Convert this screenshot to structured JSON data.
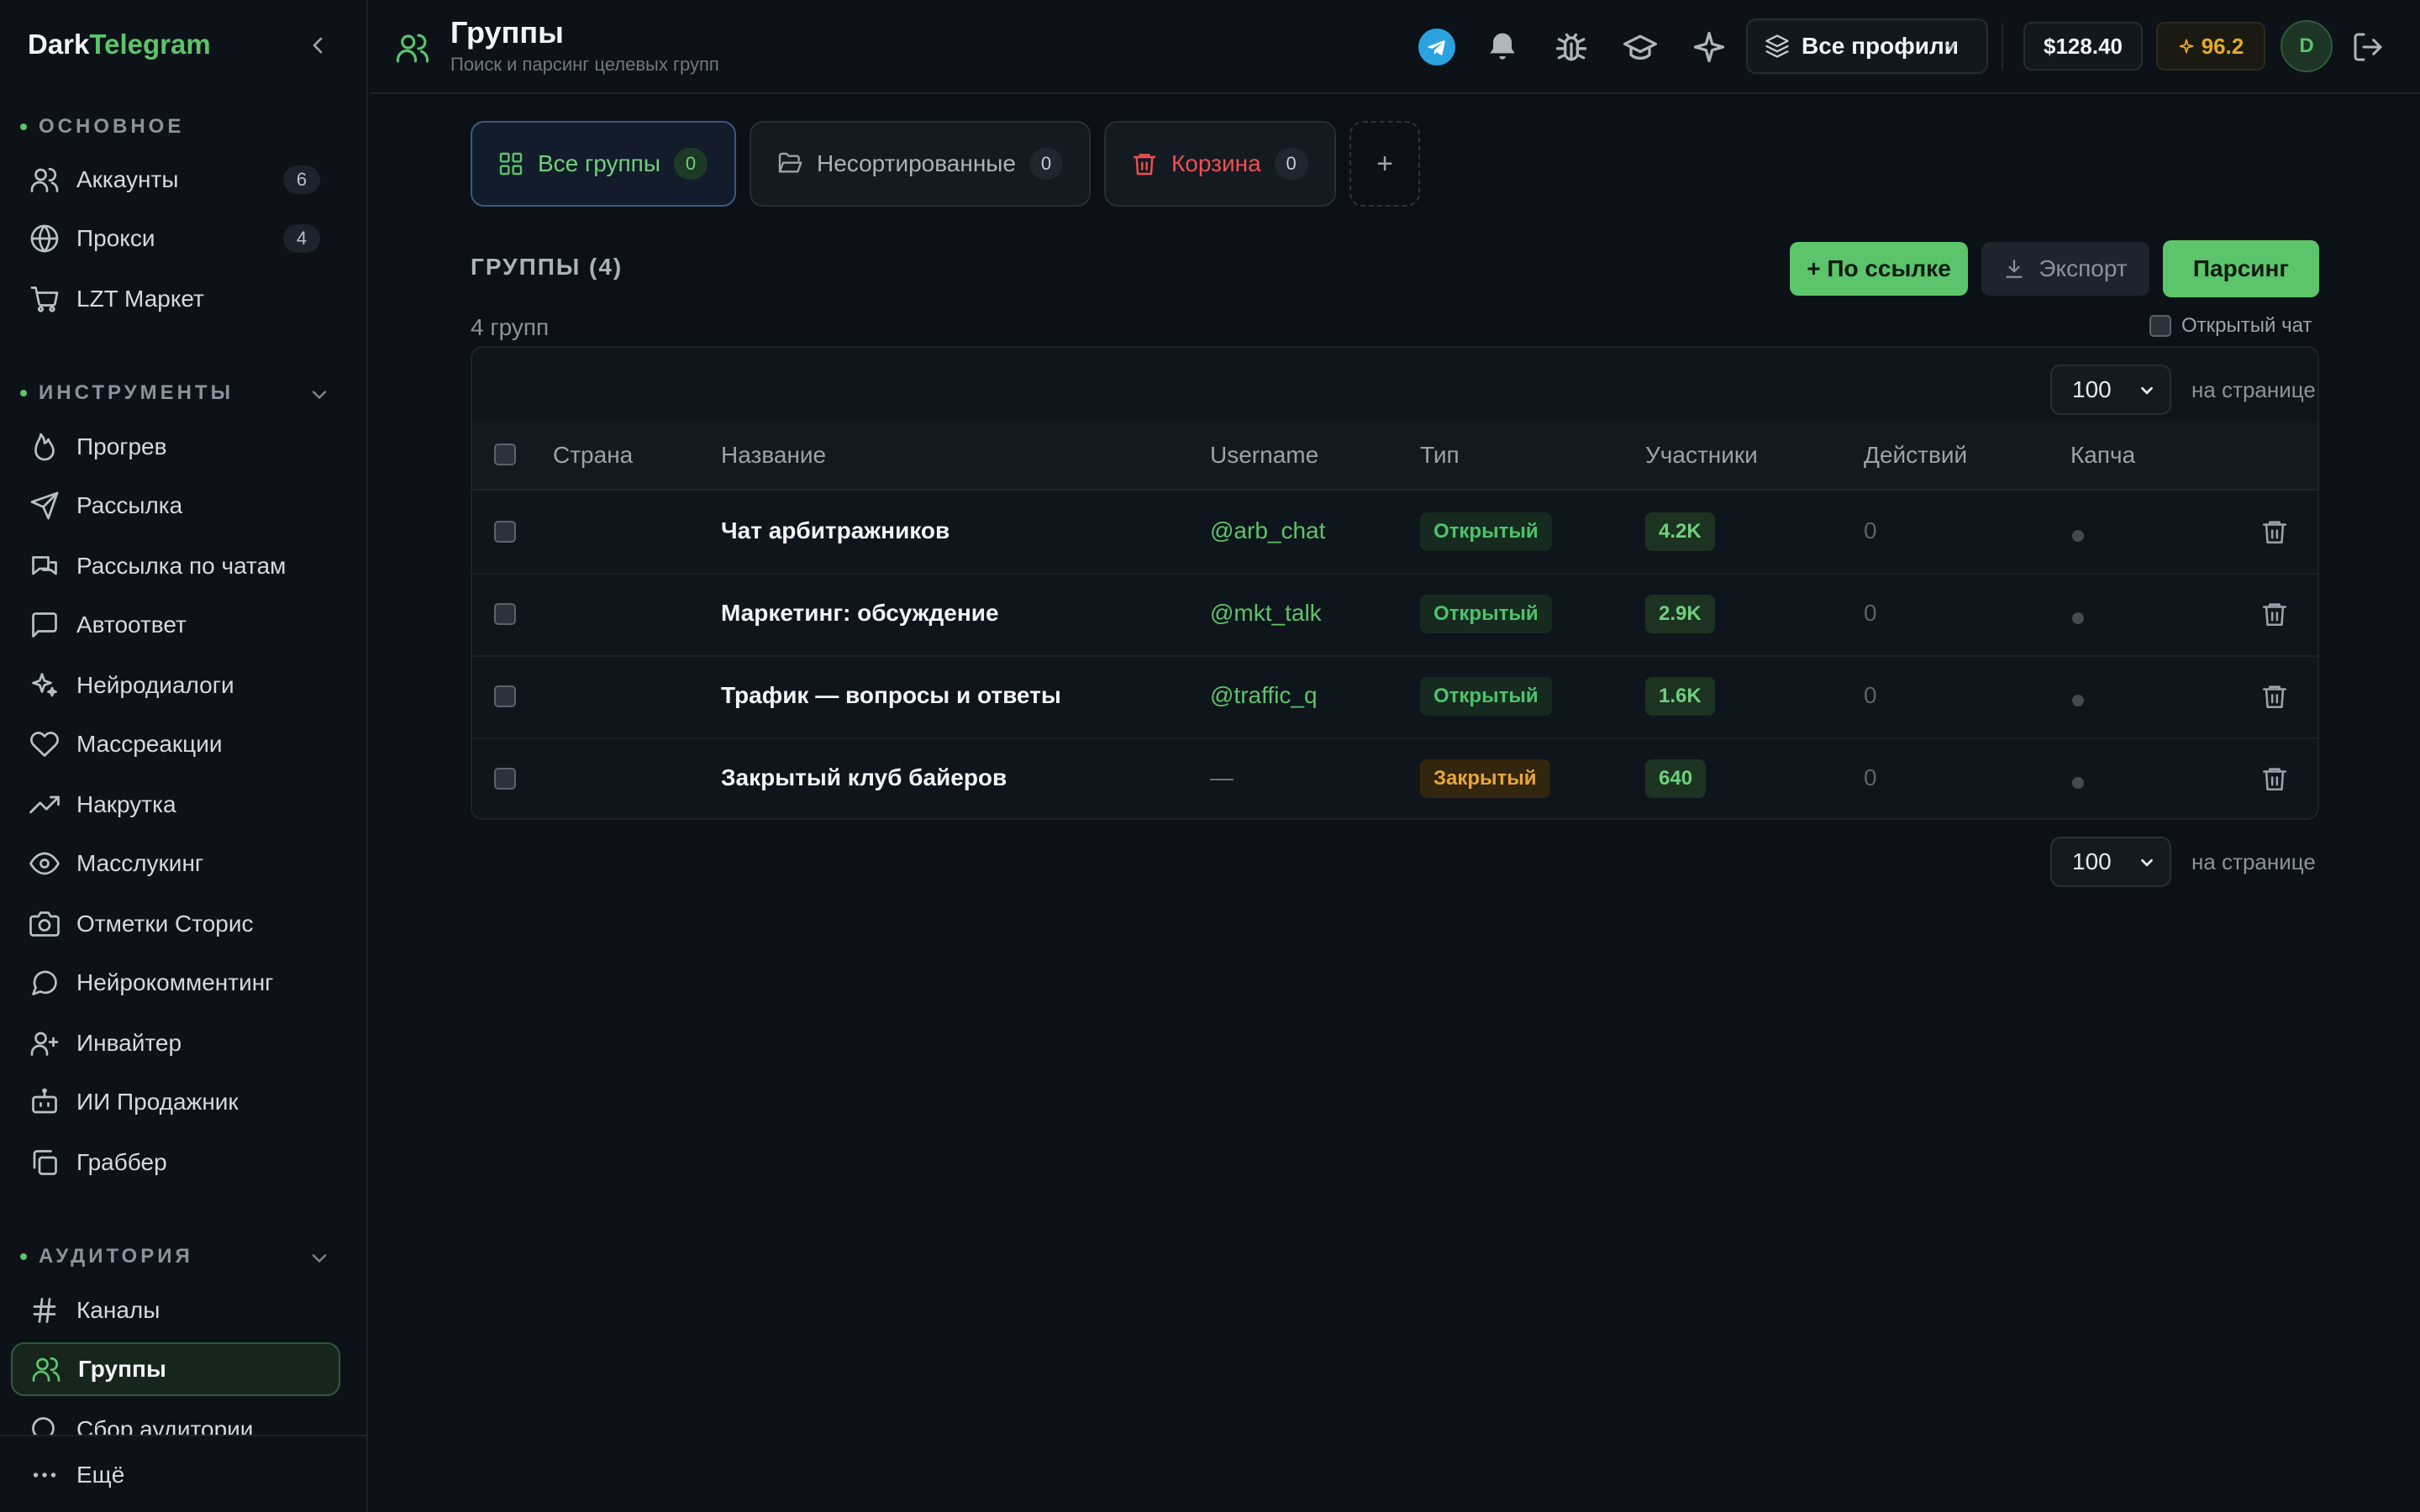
{
  "brand": {
    "part1": "Dark",
    "part2": "Telegram"
  },
  "sidebar": {
    "sections": {
      "main": "ОСНОВНОЕ",
      "tools": "ИНСТРУМЕНТЫ",
      "audience": "АУДИТОРИЯ"
    },
    "main_items": [
      {
        "label": "Аккаунты",
        "count": "6",
        "icon": "users-icon"
      },
      {
        "label": "Прокси",
        "count": "4",
        "icon": "globe-icon"
      },
      {
        "label": "LZT Маркет",
        "icon": "cart-icon"
      }
    ],
    "tools_items": [
      {
        "label": "Прогрев",
        "icon": "flame-icon"
      },
      {
        "label": "Рассылка",
        "icon": "send-icon"
      },
      {
        "label": "Рассылка по чатам",
        "icon": "chats-icon"
      },
      {
        "label": "Автоответ",
        "icon": "message-square-icon"
      },
      {
        "label": "Нейродиалоги",
        "icon": "sparkles-icon"
      },
      {
        "label": "Массреакции",
        "icon": "heart-icon"
      },
      {
        "label": "Накрутка",
        "icon": "trending-up-icon"
      },
      {
        "label": "Масслукинг",
        "icon": "eye-icon"
      },
      {
        "label": "Отметки Сторис",
        "icon": "camera-icon"
      },
      {
        "label": "Нейрокомментинг",
        "icon": "message-circle-icon"
      },
      {
        "label": "Инвайтер",
        "icon": "user-plus-icon"
      },
      {
        "label": "ИИ Продажник",
        "icon": "bot-icon"
      },
      {
        "label": "Граббер",
        "icon": "copy-icon"
      }
    ],
    "audience_items": [
      {
        "label": "Каналы",
        "icon": "hash-icon"
      },
      {
        "label": "Группы",
        "icon": "users-icon",
        "active": true
      },
      {
        "label": "Сбор аудитории",
        "icon": "search-icon"
      }
    ],
    "more_label": "Ещё"
  },
  "header": {
    "title": "Группы",
    "subtitle": "Поиск и парсинг целевых групп",
    "profile_select": "Все профили",
    "balance": "$128.40",
    "rating": "96.2",
    "avatar": "D"
  },
  "folders": [
    {
      "label": "Все группы",
      "count": "0",
      "active": true
    },
    {
      "label": "Несортированные",
      "count": "0"
    },
    {
      "label": "Корзина",
      "count": "0",
      "trash": true
    }
  ],
  "add_folder": "+",
  "section": {
    "title": "ГРУППЫ (4)",
    "count_text": "4 групп",
    "btn_link": "+ По ссылке",
    "btn_export": "Экспорт",
    "btn_parse": "Парсинг",
    "open_chat_label": "Открытый чат"
  },
  "pagination": {
    "per_page": "100",
    "label": "на странице"
  },
  "table": {
    "headers": [
      "Страна",
      "Название",
      "Username",
      "Тип",
      "Участники",
      "Действий",
      "Капча"
    ],
    "rows": [
      {
        "country": "",
        "name": "Чат арбитражников",
        "username": "@arb_chat",
        "type": "Открытый",
        "type_kind": "open",
        "members": "4.2K",
        "actions": "0"
      },
      {
        "country": "",
        "name": "Маркетинг: обсуждение",
        "username": "@mkt_talk",
        "type": "Открытый",
        "type_kind": "open",
        "members": "2.9K",
        "actions": "0"
      },
      {
        "country": "",
        "name": "Трафик — вопросы и ответы",
        "username": "@traffic_q",
        "type": "Открытый",
        "type_kind": "open",
        "members": "1.6K",
        "actions": "0"
      },
      {
        "country": "",
        "name": "Закрытый клуб байеров",
        "username": "—",
        "type": "Закрытый",
        "type_kind": "closed",
        "members": "640",
        "actions": "0"
      }
    ]
  },
  "colors": {
    "accent": "#5cc46a",
    "danger": "#ef4f4f",
    "warning": "#e8a73a",
    "background": "#0c1117"
  }
}
